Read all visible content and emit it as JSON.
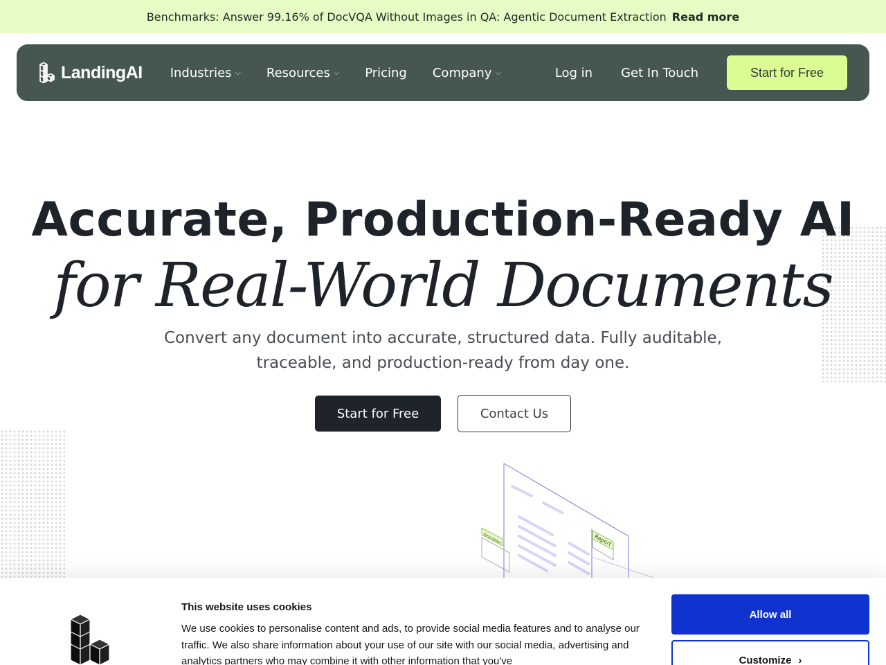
{
  "banner": {
    "text": "Benchmarks: Answer 99.16% of DocVQA Without Images in QA: Agentic Document Extraction",
    "link": "Read more"
  },
  "nav": {
    "brand": "LandingAI",
    "items": [
      {
        "label": "Industries",
        "has_dropdown": true
      },
      {
        "label": "Resources",
        "has_dropdown": true
      },
      {
        "label": "Pricing",
        "has_dropdown": false
      },
      {
        "label": "Company",
        "has_dropdown": true
      }
    ],
    "login": "Log in",
    "contact": "Get In Touch",
    "cta": "Start for Free"
  },
  "hero": {
    "title": "Accurate, Production-Ready AI",
    "subtitle": "for Real-World Documents",
    "description": "Convert any document into accurate, structured data. Fully auditable, traceable, and production-ready from day one.",
    "primary_button": "Start for Free",
    "secondary_button": "Contact Us"
  },
  "illustration": {
    "tag_left": "Description",
    "tag_right": "Report"
  },
  "cookie": {
    "title": "This website uses cookies",
    "body": "We use cookies to personalise content and ads, to provide social media features and to analyse our traffic. We also share information about your use of our site with our social media, advertising and analytics partners who may combine it with other information that you've",
    "allow": "Allow all",
    "customize": "Customize"
  },
  "colors": {
    "banner_bg": "#e6fcc4",
    "nav_bg": "#455750",
    "cta_bg": "#dafc93",
    "primary_dark": "#1f242b",
    "cookie_accent": "#1032cf"
  }
}
